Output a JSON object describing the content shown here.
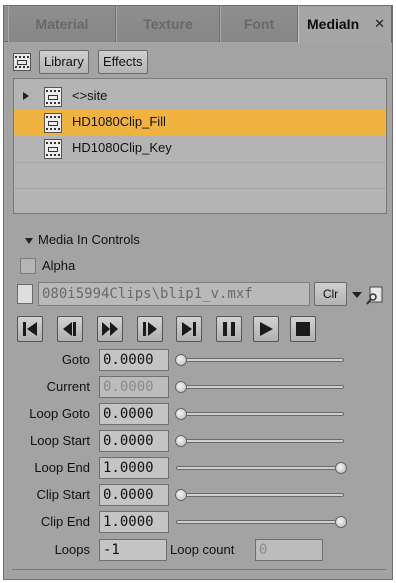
{
  "tabs": [
    {
      "label": "Material"
    },
    {
      "label": "Texture"
    },
    {
      "label": "Font"
    },
    {
      "label": "MediaIn",
      "close": "✕"
    }
  ],
  "toolbar": {
    "library": "Library",
    "effects": "Effects"
  },
  "tree": {
    "items": [
      {
        "label": "<>site",
        "expandable": true,
        "selected": false
      },
      {
        "label": "HD1080Clip_Fill",
        "selected": true
      },
      {
        "label": "HD1080Clip_Key",
        "selected": false
      }
    ]
  },
  "controls": {
    "title": "Media In Controls",
    "alpha_label": "Alpha",
    "alpha_checked": false,
    "file_path": "080i5994Clips\\blip1_v.mxf",
    "clear_label": "Clr"
  },
  "transport": [
    "go-to-start",
    "step-back",
    "fast-forward",
    "step-forward",
    "go-to-end",
    "pause",
    "play",
    "stop"
  ],
  "params": [
    {
      "label": "Goto",
      "value": "0.0000",
      "level": 0,
      "disabled": false
    },
    {
      "label": "Current",
      "value": "0.0000",
      "level": 0,
      "disabled": true
    },
    {
      "label": "Loop Goto",
      "value": "0.0000",
      "level": 0,
      "disabled": false
    },
    {
      "label": "Loop Start",
      "value": "0.0000",
      "level": 0,
      "disabled": false
    },
    {
      "label": "Loop End",
      "value": "1.0000",
      "level": 1,
      "disabled": false
    },
    {
      "label": "Clip Start",
      "value": "0.0000",
      "level": 0,
      "disabled": false
    },
    {
      "label": "Clip End",
      "value": "1.0000",
      "level": 1,
      "disabled": false
    }
  ],
  "loops": {
    "label": "Loops",
    "value": "-1",
    "count_label": "Loop count",
    "count_value": "0"
  },
  "colors": {
    "selection": "#f0b33f",
    "panel": "#a3a3a3"
  }
}
